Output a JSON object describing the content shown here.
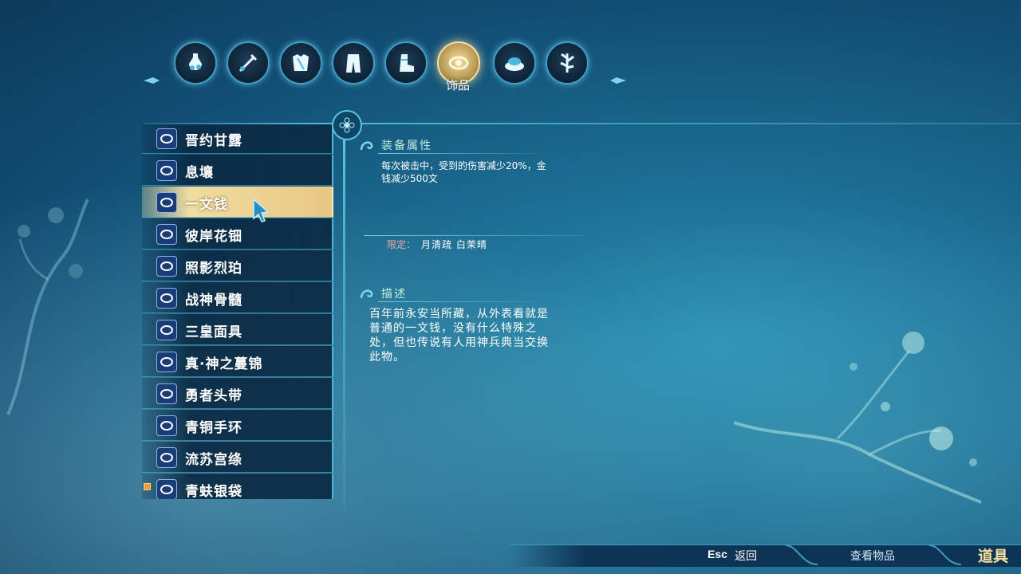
{
  "categories": {
    "tabs": [
      {
        "name": "potion-icon"
      },
      {
        "name": "weapon-icon"
      },
      {
        "name": "armor-icon"
      },
      {
        "name": "pants-icon"
      },
      {
        "name": "boots-icon"
      },
      {
        "name": "accessory-icon"
      },
      {
        "name": "food-icon"
      },
      {
        "name": "material-icon"
      }
    ],
    "active_index": 5,
    "active_label": "饰品"
  },
  "items": [
    {
      "label": "晋约甘露"
    },
    {
      "label": "息壤"
    },
    {
      "label": "一文钱"
    },
    {
      "label": "彼岸花钿"
    },
    {
      "label": "照影烈珀"
    },
    {
      "label": "战神骨髓"
    },
    {
      "label": "三皇面具"
    },
    {
      "label": "真·神之蔓锦"
    },
    {
      "label": "勇者头带"
    },
    {
      "label": "青铜手环"
    },
    {
      "label": "流苏宫绦"
    },
    {
      "label": "青蚨银袋"
    }
  ],
  "selected_item": "一文钱",
  "attributes": {
    "heading": "装备属性",
    "text": "每次被击中，受到的伤害减少20%，金钱减少500文",
    "limit_label": "限定：",
    "limit_value": "月清疏  白茉晴"
  },
  "description": {
    "heading": "描述",
    "text": "百年前永安当所藏，从外表看就是普通的一文钱，没有什么特殊之处，但也传说有人用神兵典当交换此物。"
  },
  "bottom": {
    "esc_key": "Esc",
    "back_label": "返回",
    "view_label": "查看物品",
    "menu_title": "道具"
  },
  "colors": {
    "accent": "#5cc4e2",
    "selected": "#f1dca0",
    "limit_label": "#f3a5a5",
    "heading": "#bfefdc",
    "menu_title": "#f5dfa0"
  }
}
